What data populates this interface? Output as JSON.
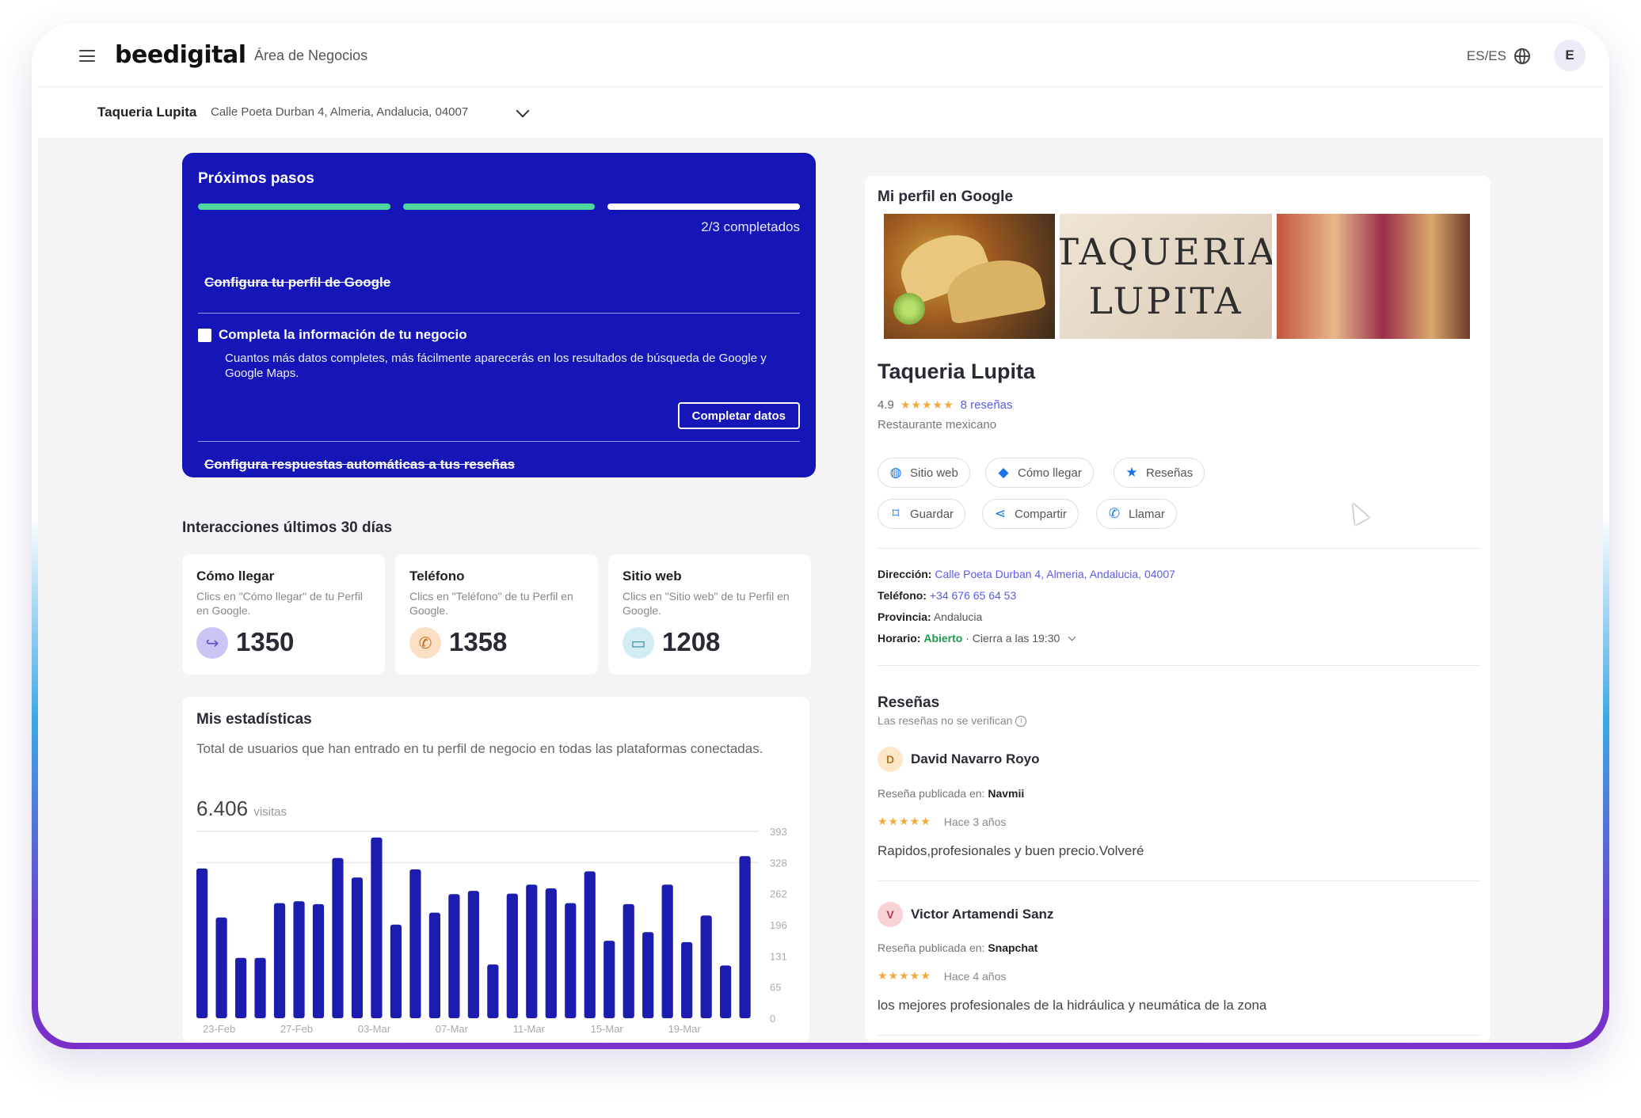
{
  "header": {
    "logo": "beedigital",
    "area_label": "Área de Negocios",
    "language": "ES/ES",
    "user_initial": "E"
  },
  "business_bar": {
    "name": "Taqueria Lupita",
    "address": "Calle Poeta Durban 4, Almeria, Andalucia, 04007"
  },
  "next_steps": {
    "title": "Próximos pasos",
    "progress_completed": 2,
    "progress_total": 3,
    "progress_label": "2/3 completados",
    "colors": {
      "done": "#4dd8a0",
      "pending": "#ffffff",
      "card": "#1616b8"
    },
    "step1": "Configura tu perfil de Google",
    "step2_title": "Completa la información de tu negocio",
    "step2_desc": "Cuantos más datos completes, más fácilmente aparecerás en los resultados de búsqueda de Google y Google Maps.",
    "step2_button": "Completar datos",
    "step3": "Configura respuestas automáticas a tus reseñas"
  },
  "interactions": {
    "title": "Interacciones últimos 30 días",
    "cards": [
      {
        "title": "Cómo llegar",
        "desc": "Clics en \"Cómo llegar\" de tu Perfil en Google.",
        "value": "1350",
        "icon": "directions-icon"
      },
      {
        "title": "Teléfono",
        "desc": "Clics en \"Teléfono\" de tu Perfil en Google.",
        "value": "1358",
        "icon": "phone-icon"
      },
      {
        "title": "Sitio web",
        "desc": "Clics en \"Sitio web\" de tu Perfil en Google.",
        "value": "1208",
        "icon": "browser-icon"
      }
    ]
  },
  "stats": {
    "title": "Mis estadísticas",
    "desc": "Total de usuarios que han entrado en tu perfil de negocio en todas las plataformas conectadas.",
    "total": "6.406",
    "total_unit": "visitas"
  },
  "chart_data": {
    "type": "bar",
    "color": "#1c1cae",
    "ylim": [
      0,
      393
    ],
    "yticks": [
      "393",
      "328",
      "262",
      "196",
      "131",
      "65",
      "0"
    ],
    "xtick_labels": [
      "23-Feb",
      "27-Feb",
      "03-Mar",
      "07-Mar",
      "11-Mar",
      "15-Mar",
      "19-Mar"
    ],
    "xtick_every": 4,
    "values": [
      315,
      212,
      127,
      127,
      242,
      246,
      240,
      337,
      296,
      380,
      197,
      313,
      222,
      261,
      268,
      113,
      262,
      281,
      273,
      242,
      309,
      163,
      240,
      181,
      281,
      160,
      216,
      111,
      341
    ]
  },
  "profile": {
    "heading": "Mi perfil en Google",
    "photo_sign": [
      "TAQUERIA",
      "LUPITA"
    ],
    "name": "Taqueria Lupita",
    "rating": "4.9",
    "stars": "★★★★★",
    "reviews_link": "8 reseñas",
    "category": "Restaurante mexicano",
    "actions": {
      "website": "Sitio web",
      "directions": "Cómo llegar",
      "reviews": "Reseñas",
      "save": "Guardar",
      "share": "Compartir",
      "call": "Llamar"
    },
    "address_label": "Dirección:",
    "address": "Calle Poeta Durban 4, Almeria, Andalucia, 04007",
    "phone_label": "Teléfono:",
    "phone": "+34 676 65 64 53",
    "province_label": "Provincia:",
    "province": "Andalucia",
    "hours_label": "Horario:",
    "hours_status": "Abierto",
    "hours_close": "· Cierra a las 19:30",
    "reviews_title": "Reseñas",
    "reviews_note": "Las reseñas no se verifican",
    "reviews": [
      {
        "initial": "D",
        "name": "David Navarro Royo",
        "source_label": "Reseña publicada en:",
        "source": "Navmii",
        "stars": "★★★★★",
        "ago": "Hace 3 años",
        "text": "Rapidos,profesionales y buen precio.Volveré",
        "avatar_color": "#fde7c9"
      },
      {
        "initial": "V",
        "name": "Victor Artamendi Sanz",
        "source_label": "Reseña publicada en:",
        "source": "Snapchat",
        "stars": "★★★★★",
        "ago": "Hace 4 años",
        "text": "los mejores profesionales de la hidráulica y neumática de la zona",
        "avatar_color": "#f9d2d8"
      }
    ]
  }
}
